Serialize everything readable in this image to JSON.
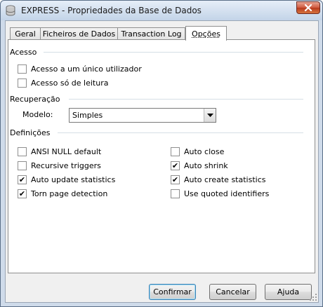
{
  "window": {
    "title": "EXPRESS - Propriedades da Base de Dados"
  },
  "tabs": [
    {
      "label": "Geral"
    },
    {
      "label": "Ficheiros de Dados"
    },
    {
      "label": "Transaction Log"
    },
    {
      "label": "Opções",
      "active": true
    }
  ],
  "sections": {
    "acesso": "Acesso",
    "recuperacao": "Recuperação",
    "definicoes": "Definições"
  },
  "acesso_options": [
    {
      "label": "Acesso a um único utilizador",
      "checked": false
    },
    {
      "label": "Acesso só de leitura",
      "checked": false
    }
  ],
  "recuperacao": {
    "modelo_label": "Modelo:",
    "modelo_value": "Simples"
  },
  "definicoes_left": [
    {
      "label": "ANSI NULL default",
      "checked": false
    },
    {
      "label": "Recursive triggers",
      "checked": false
    },
    {
      "label": "Auto update statistics",
      "checked": true
    },
    {
      "label": "Torn page detection",
      "checked": true
    }
  ],
  "definicoes_right": [
    {
      "label": "Auto close",
      "checked": false
    },
    {
      "label": "Auto shrink",
      "checked": true
    },
    {
      "label": "Auto create statistics",
      "checked": true
    },
    {
      "label": "Use quoted identifiers",
      "checked": false
    }
  ],
  "buttons": {
    "confirm": "Confirmar",
    "cancel": "Cancelar",
    "help": "Ajuda"
  },
  "colors": {
    "close_button": "#c9472c",
    "tab_border": "#8e8f8f",
    "default_button_border": "#3c7fb1"
  }
}
